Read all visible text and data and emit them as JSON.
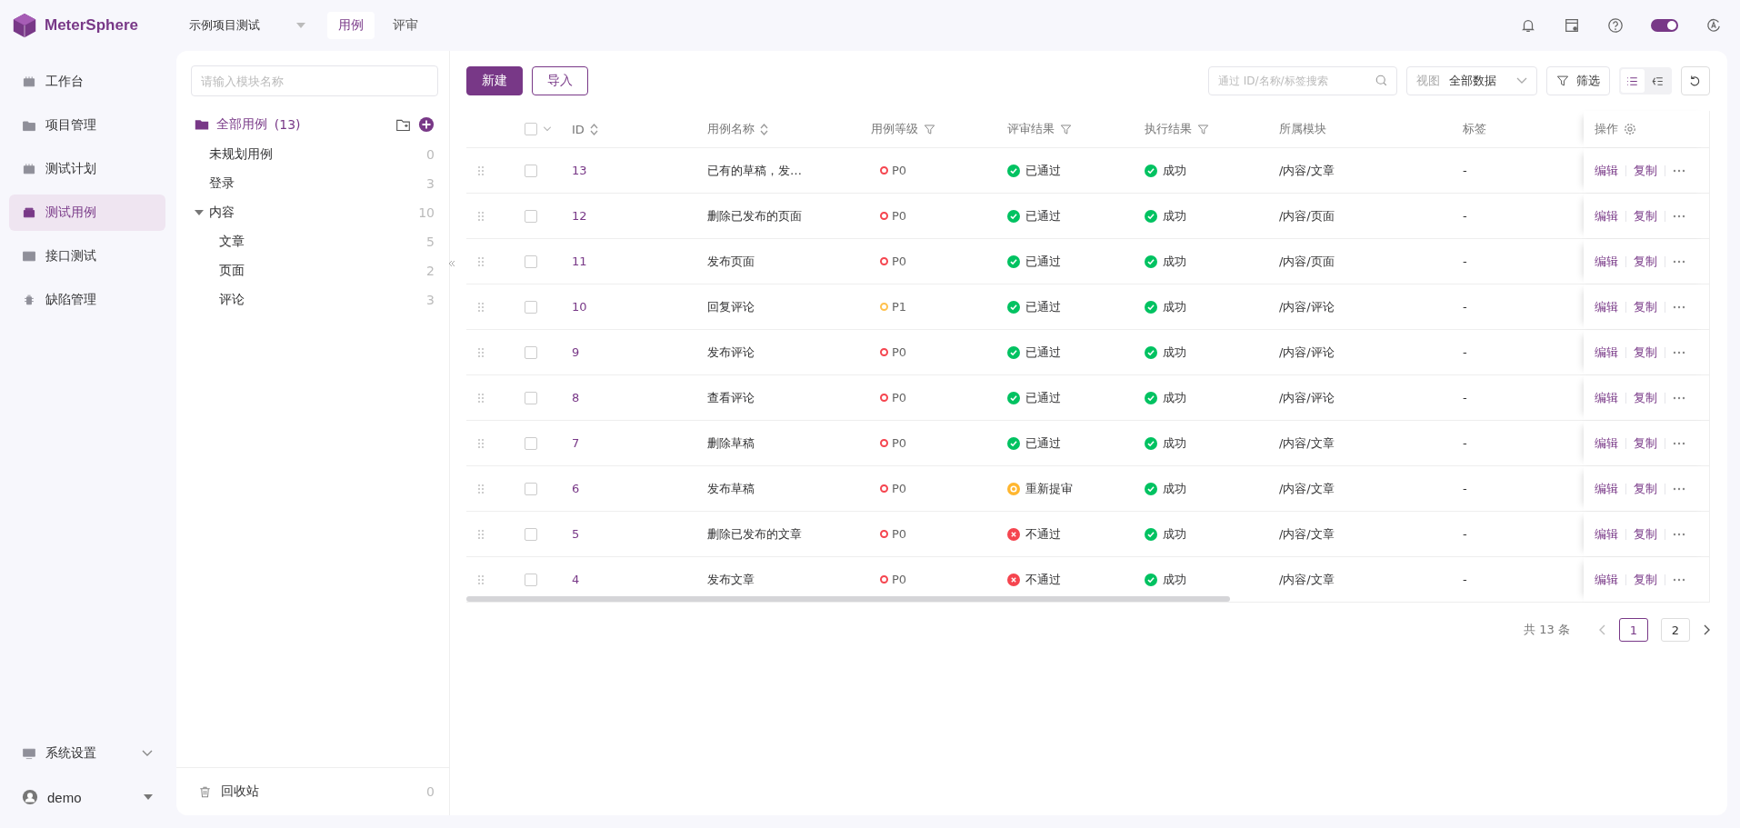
{
  "brand": "MeterSphere",
  "project": "示例项目测试",
  "top_tabs": [
    {
      "label": "用例",
      "selected": true
    },
    {
      "label": "评审",
      "selected": false
    }
  ],
  "header_toggle": {
    "on": true
  },
  "nav": [
    {
      "label": "工作台",
      "selected": false
    },
    {
      "label": "项目管理",
      "selected": false
    },
    {
      "label": "测试计划",
      "selected": false
    },
    {
      "label": "测试用例",
      "selected": true
    },
    {
      "label": "接口测试",
      "selected": false
    },
    {
      "label": "缺陷管理",
      "selected": false
    }
  ],
  "nav_settings": {
    "label": "系统设置"
  },
  "user": {
    "name": "demo"
  },
  "tree": {
    "placeholder": "请输入模块名称",
    "root": {
      "label": "全部用例",
      "count": "(13)",
      "selected": true
    },
    "items": [
      {
        "label": "未规划用例",
        "count": "0"
      },
      {
        "label": "登录",
        "count": "3"
      },
      {
        "label": "内容",
        "count": "10",
        "expanded": true,
        "children": [
          {
            "label": "文章",
            "count": "5"
          },
          {
            "label": "页面",
            "count": "2"
          },
          {
            "label": "评论",
            "count": "3"
          }
        ]
      }
    ],
    "recycle": {
      "label": "回收站",
      "count": "0"
    }
  },
  "toolbar": {
    "create": "新建",
    "import": "导入",
    "search_placeholder": "通过 ID/名称/标签搜索",
    "view_label": "视图",
    "view_value": "全部数据",
    "filter": "筛选",
    "modes": [
      {
        "kind": "list",
        "selected": true
      },
      {
        "kind": "tree",
        "selected": false
      }
    ]
  },
  "select_all": {
    "checked": false
  },
  "columns": [
    {
      "label": "ID",
      "kind": "sort"
    },
    {
      "label": "用例名称",
      "kind": "sort"
    },
    {
      "label": "用例等级",
      "kind": "filter"
    },
    {
      "label": "评审结果",
      "kind": "filter"
    },
    {
      "label": "执行结果",
      "kind": "filter"
    },
    {
      "label": "所属模块",
      "kind": "plain"
    },
    {
      "label": "标签",
      "kind": "plain"
    },
    {
      "label": "操作",
      "kind": "settings"
    }
  ],
  "rows": [
    {
      "checked": false,
      "id": "13",
      "name": "已有的草稿，发…",
      "level": "P0",
      "color": "#f5454f",
      "review": {
        "kind": "pass",
        "text": "已通过"
      },
      "result": {
        "kind": "success",
        "text": "成功"
      },
      "module": "/内容/文章",
      "tags": "-",
      "actions": [
        "编辑",
        "复制"
      ]
    },
    {
      "checked": false,
      "id": "12",
      "name": "删除已发布的页面",
      "level": "P0",
      "color": "#f5454f",
      "review": {
        "kind": "pass",
        "text": "已通过"
      },
      "result": {
        "kind": "success",
        "text": "成功"
      },
      "module": "/内容/页面",
      "tags": "-",
      "actions": [
        "编辑",
        "复制"
      ]
    },
    {
      "checked": false,
      "id": "11",
      "name": "发布页面",
      "level": "P0",
      "color": "#f5454f",
      "review": {
        "kind": "pass",
        "text": "已通过"
      },
      "result": {
        "kind": "success",
        "text": "成功"
      },
      "module": "/内容/页面",
      "tags": "-",
      "actions": [
        "编辑",
        "复制"
      ]
    },
    {
      "checked": false,
      "id": "10",
      "name": "回复评论",
      "level": "P1",
      "color": "#ffc14e",
      "review": {
        "kind": "pass",
        "text": "已通过"
      },
      "result": {
        "kind": "success",
        "text": "成功"
      },
      "module": "/内容/评论",
      "tags": "-",
      "actions": [
        "编辑",
        "复制"
      ]
    },
    {
      "checked": false,
      "id": "9",
      "name": "发布评论",
      "level": "P0",
      "color": "#f5454f",
      "review": {
        "kind": "pass",
        "text": "已通过"
      },
      "result": {
        "kind": "success",
        "text": "成功"
      },
      "module": "/内容/评论",
      "tags": "-",
      "actions": [
        "编辑",
        "复制"
      ]
    },
    {
      "checked": false,
      "id": "8",
      "name": "查看评论",
      "level": "P0",
      "color": "#f5454f",
      "review": {
        "kind": "pass",
        "text": "已通过"
      },
      "result": {
        "kind": "success",
        "text": "成功"
      },
      "module": "/内容/评论",
      "tags": "-",
      "actions": [
        "编辑",
        "复制"
      ]
    },
    {
      "checked": false,
      "id": "7",
      "name": "删除草稿",
      "level": "P0",
      "color": "#f5454f",
      "review": {
        "kind": "pass",
        "text": "已通过"
      },
      "result": {
        "kind": "success",
        "text": "成功"
      },
      "module": "/内容/文章",
      "tags": "-",
      "actions": [
        "编辑",
        "复制"
      ]
    },
    {
      "checked": false,
      "id": "6",
      "name": "发布草稿",
      "level": "P0",
      "color": "#f5454f",
      "review": {
        "kind": "resubmit",
        "text": "重新提审"
      },
      "result": {
        "kind": "success",
        "text": "成功"
      },
      "module": "/内容/文章",
      "tags": "-",
      "actions": [
        "编辑",
        "复制"
      ]
    },
    {
      "checked": false,
      "id": "5",
      "name": "删除已发布的文章",
      "level": "P0",
      "color": "#f5454f",
      "review": {
        "kind": "fail",
        "text": "不通过"
      },
      "result": {
        "kind": "success",
        "text": "成功"
      },
      "module": "/内容/文章",
      "tags": "-",
      "actions": [
        "编辑",
        "复制"
      ]
    },
    {
      "checked": false,
      "id": "4",
      "name": "发布文章",
      "level": "P0",
      "color": "#f5454f",
      "review": {
        "kind": "fail",
        "text": "不通过"
      },
      "result": {
        "kind": "success",
        "text": "成功"
      },
      "module": "/内容/文章",
      "tags": "-",
      "actions": [
        "编辑",
        "复制"
      ]
    }
  ],
  "pagination": {
    "total": "共 13 条",
    "pages": [
      {
        "label": "1",
        "selected": true
      },
      {
        "label": "2",
        "selected": false
      }
    ]
  }
}
